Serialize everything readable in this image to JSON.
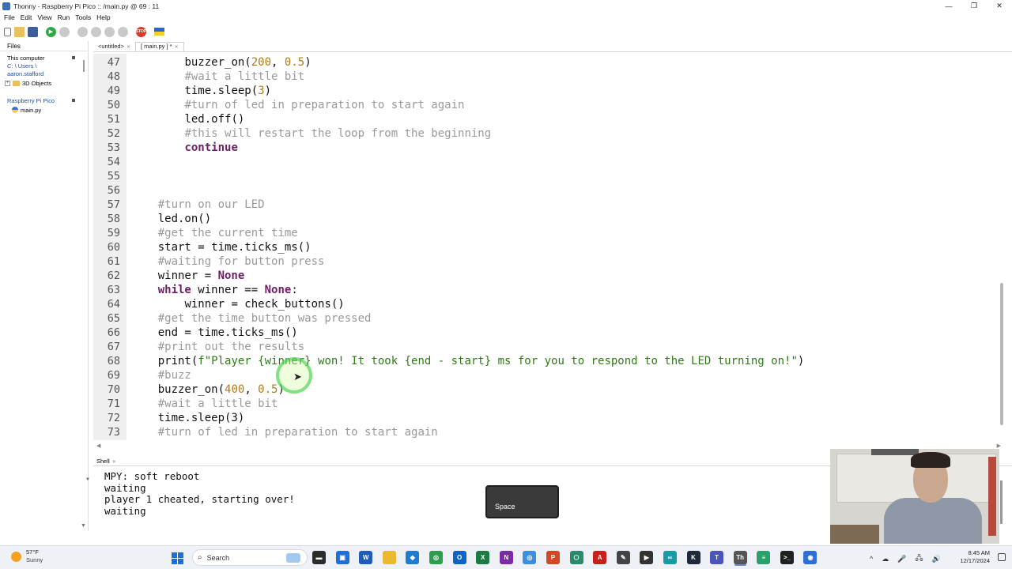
{
  "window": {
    "title": "Thonny  -  Raspberry Pi Pico :: /main.py  @  69 : 11",
    "controls": {
      "minimize": "—",
      "maximize": "❐",
      "close": "✕"
    }
  },
  "menu": [
    "File",
    "Edit",
    "View",
    "Run",
    "Tools",
    "Help"
  ],
  "toolbar": {
    "icons": [
      "new-file-icon",
      "open-icon",
      "save-icon",
      "run-icon",
      "debug-icon",
      "step-over-icon",
      "step-into-icon",
      "step-out-icon",
      "resume-icon",
      "stop-icon",
      "ukraine-flag-icon"
    ],
    "stop_label": "STOP"
  },
  "files_panel": {
    "tab": "Files",
    "this_computer": {
      "label": "This computer",
      "path_1": "C: \\ Users \\",
      "path_2": "aaron.stafford"
    },
    "local_items": [
      {
        "name": "3D Objects",
        "icon": "folder-icon"
      }
    ],
    "device": {
      "label": "Raspberry Pi Pico",
      "items": [
        {
          "name": "main.py",
          "icon": "python-file-icon"
        }
      ]
    }
  },
  "editor": {
    "tabs": [
      {
        "label": "<untitled>",
        "active": false
      },
      {
        "label": "[ main.py ] *",
        "active": true
      }
    ],
    "lines": [
      {
        "n": "47",
        "indent": "        ",
        "parts": [
          [
            "buzzer_on(",
            ""
          ],
          [
            "200",
            "num"
          ],
          [
            ", ",
            ""
          ],
          [
            "0.5",
            "num"
          ],
          [
            ")",
            ""
          ]
        ]
      },
      {
        "n": "48",
        "indent": "        ",
        "parts": [
          [
            "#wait a little bit",
            "comment"
          ]
        ]
      },
      {
        "n": "49",
        "indent": "        ",
        "parts": [
          [
            "time.sleep(",
            ""
          ],
          [
            "3",
            "num"
          ],
          [
            ")",
            ""
          ]
        ]
      },
      {
        "n": "50",
        "indent": "        ",
        "parts": [
          [
            "#turn of led in preparation to start again",
            "comment"
          ]
        ]
      },
      {
        "n": "51",
        "indent": "        ",
        "parts": [
          [
            "led.off()",
            ""
          ]
        ]
      },
      {
        "n": "52",
        "indent": "        ",
        "parts": [
          [
            "#this will restart the loop from the beginning",
            "comment"
          ]
        ]
      },
      {
        "n": "53",
        "indent": "        ",
        "parts": [
          [
            "continue",
            "kw"
          ]
        ]
      },
      {
        "n": "54",
        "indent": "",
        "parts": []
      },
      {
        "n": "55",
        "indent": "",
        "parts": []
      },
      {
        "n": "56",
        "indent": "",
        "parts": []
      },
      {
        "n": "57",
        "indent": "    ",
        "parts": [
          [
            "#turn on our LED",
            "comment"
          ]
        ]
      },
      {
        "n": "58",
        "indent": "    ",
        "parts": [
          [
            "led.on()",
            ""
          ]
        ]
      },
      {
        "n": "59",
        "indent": "    ",
        "parts": [
          [
            "#get the current time",
            "comment"
          ]
        ]
      },
      {
        "n": "60",
        "indent": "    ",
        "parts": [
          [
            "start = time.ticks_ms()",
            ""
          ]
        ]
      },
      {
        "n": "61",
        "indent": "    ",
        "parts": [
          [
            "#waiting for button press",
            "comment"
          ]
        ]
      },
      {
        "n": "62",
        "indent": "    ",
        "parts": [
          [
            "winner = ",
            ""
          ],
          [
            "None",
            "kw"
          ]
        ]
      },
      {
        "n": "63",
        "indent": "    ",
        "parts": [
          [
            "while",
            "kw"
          ],
          [
            " winner == ",
            ""
          ],
          [
            "None",
            "kw"
          ],
          [
            ":",
            ""
          ]
        ]
      },
      {
        "n": "64",
        "indent": "        ",
        "parts": [
          [
            "winner = check_buttons()",
            ""
          ]
        ]
      },
      {
        "n": "65",
        "indent": "    ",
        "parts": [
          [
            "#get the time button was pressed",
            "comment"
          ]
        ]
      },
      {
        "n": "66",
        "indent": "    ",
        "parts": [
          [
            "end = time.ticks_ms()",
            ""
          ]
        ]
      },
      {
        "n": "67",
        "indent": "    ",
        "parts": [
          [
            "#print out the results",
            "comment"
          ]
        ]
      },
      {
        "n": "68",
        "indent": "    ",
        "parts": [
          [
            "print(",
            ""
          ],
          [
            "f\"Player {winner} won! It took {end - start} ms for you to respond to the LED turning on!\"",
            "str"
          ],
          [
            ")",
            ""
          ]
        ]
      },
      {
        "n": "69",
        "indent": "    ",
        "parts": [
          [
            "#buzz",
            "comment"
          ]
        ]
      },
      {
        "n": "70",
        "indent": "    ",
        "parts": [
          [
            "buzzer_on(",
            ""
          ],
          [
            "400",
            "num"
          ],
          [
            ", ",
            ""
          ],
          [
            "0.5",
            "num"
          ],
          [
            ")",
            ""
          ]
        ]
      },
      {
        "n": "71",
        "indent": "    ",
        "parts": [
          [
            "#wait a little bit",
            "comment"
          ]
        ]
      },
      {
        "n": "72",
        "indent": "    ",
        "parts": [
          [
            "time.sleep(3)",
            ""
          ]
        ]
      },
      {
        "n": "73",
        "indent": "    ",
        "parts": [
          [
            "#turn of led in preparation to start again",
            "comment"
          ]
        ]
      }
    ]
  },
  "shell": {
    "tab": "Shell",
    "lines": [
      "MPY: soft reboot",
      "waiting",
      "player 1 cheated, starting over!",
      "waiting"
    ]
  },
  "key_overlay": {
    "label": "Space"
  },
  "taskbar": {
    "weather": {
      "temp": "57°F",
      "condition": "Sunny"
    },
    "search_label": "Search",
    "apps": [
      {
        "name": "file-explorer-icon",
        "color": "#2b2b2b",
        "glyph": "▬"
      },
      {
        "name": "store-icon",
        "color": "#1f6fd6",
        "glyph": "▣"
      },
      {
        "name": "word-icon",
        "color": "#1f5bb8",
        "glyph": "W"
      },
      {
        "name": "folder-icon",
        "color": "#e9b92f",
        "glyph": ""
      },
      {
        "name": "vscode-icon",
        "color": "#1f7ad1",
        "glyph": "◆"
      },
      {
        "name": "chrome-icon",
        "color": "#2e9e4e",
        "glyph": "◎"
      },
      {
        "name": "outlook-icon",
        "color": "#0f63c2",
        "glyph": "O"
      },
      {
        "name": "excel-icon",
        "color": "#1d7a44",
        "glyph": "X"
      },
      {
        "name": "onenote-icon",
        "color": "#7b2ba3",
        "glyph": "N"
      },
      {
        "name": "chrome-profile-icon",
        "color": "#3e8ee0",
        "glyph": "◎"
      },
      {
        "name": "powerpoint-icon",
        "color": "#d24726",
        "glyph": "P"
      },
      {
        "name": "app-hex-icon",
        "color": "#2a8a6b",
        "glyph": "⬡"
      },
      {
        "name": "acrobat-icon",
        "color": "#c8211b",
        "glyph": "A"
      },
      {
        "name": "app-feather-icon",
        "color": "#444444",
        "glyph": "✎"
      },
      {
        "name": "media-icon",
        "color": "#333333",
        "glyph": "▶"
      },
      {
        "name": "arduino-icon",
        "color": "#1a9aa4",
        "glyph": "∞"
      },
      {
        "name": "terminal-k-icon",
        "color": "#1e2a3a",
        "glyph": "K"
      },
      {
        "name": "teams-icon",
        "color": "#4b53bc",
        "glyph": "T"
      },
      {
        "name": "thonny-icon",
        "color": "#555555",
        "glyph": "Th"
      },
      {
        "name": "notes-app-icon",
        "color": "#2aa06a",
        "glyph": "≡"
      },
      {
        "name": "cmd-icon",
        "color": "#202020",
        "glyph": ">_"
      },
      {
        "name": "settings-blue-icon",
        "color": "#2f6fd3",
        "glyph": "◉"
      }
    ],
    "tray_icons": [
      "^",
      "☁",
      "🎤",
      "🖧",
      "🔊"
    ],
    "time": "8:45 AM",
    "date": "12/17/2024"
  }
}
